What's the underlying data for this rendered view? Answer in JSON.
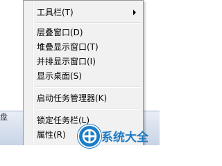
{
  "taskbar": {
    "left_fragment": "盘"
  },
  "context_menu": {
    "items": [
      {
        "label": "工具栏(T)",
        "has_submenu": true
      },
      {
        "label": "层叠窗口(D)"
      },
      {
        "label": "堆叠显示窗口(T)"
      },
      {
        "label": "并排显示窗口(I)"
      },
      {
        "label": "显示桌面(S)"
      },
      {
        "label": "启动任务管理器(K)"
      },
      {
        "label": "锁定任务栏(L)"
      },
      {
        "label": "属性(R)"
      }
    ]
  },
  "watermark": {
    "text": "系统大全",
    "icon": "logo-icon"
  },
  "colors": {
    "menu_bg": "#f1f1f1",
    "menu_border": "#979797",
    "watermark": "#1e7cc6"
  }
}
